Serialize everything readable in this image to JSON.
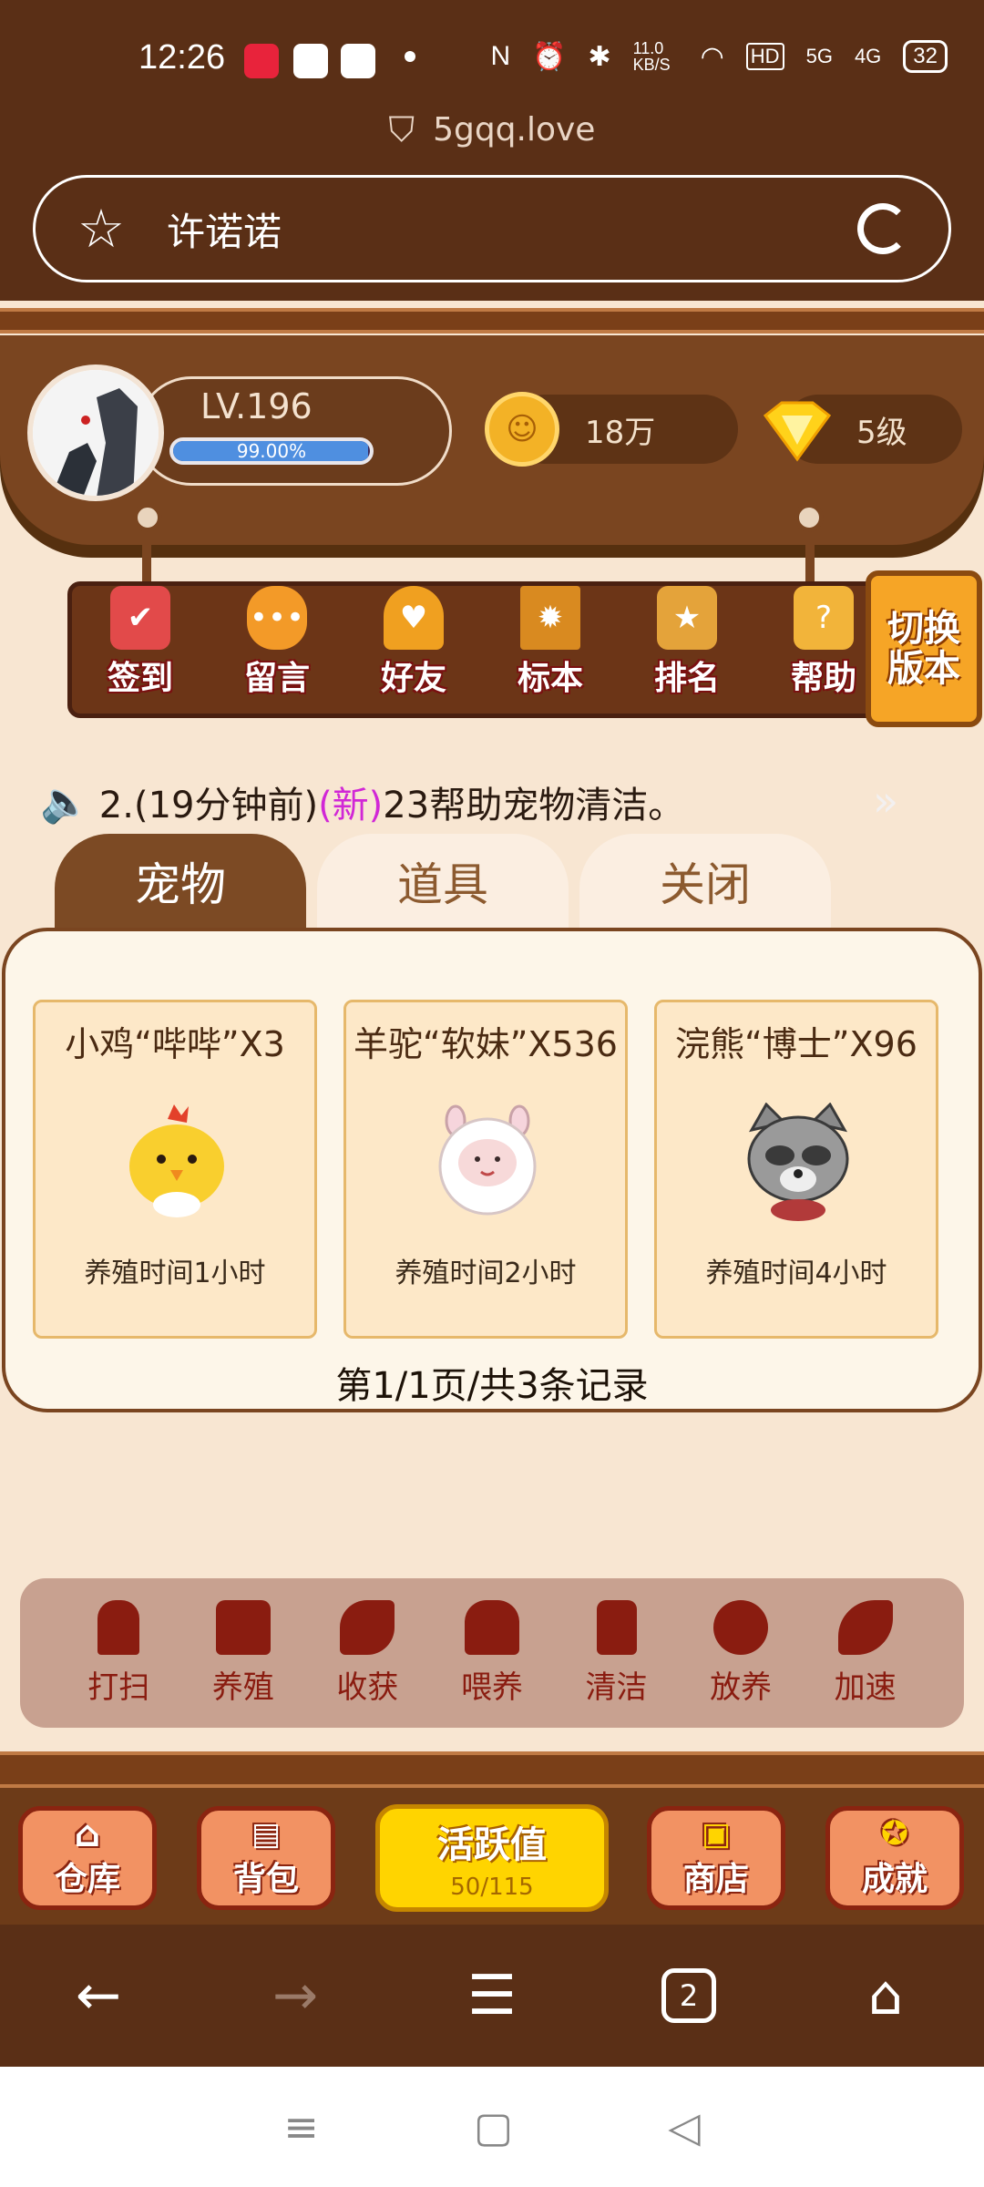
{
  "status": {
    "time": "12:26",
    "net_speed": "11.0 KB/S",
    "battery": "32",
    "hd_label": "HD",
    "sig1": "5G",
    "sig2": "4G"
  },
  "browser": {
    "url": "5gqq.love",
    "address_text": "许诺诺",
    "tab_count": "2"
  },
  "profile": {
    "level": "LV.196",
    "progress_pct": 0.99,
    "progress_label": "99.00%",
    "coins": "18万",
    "gem_level": "5级"
  },
  "nav": [
    {
      "label": "签到",
      "color": "#e24a4a"
    },
    {
      "label": "留言",
      "color": "#f39a28"
    },
    {
      "label": "好友",
      "color": "#f0a020"
    },
    {
      "label": "标本",
      "color": "#d98a20"
    },
    {
      "label": "排名",
      "color": "#e4a33a"
    },
    {
      "label": "帮助",
      "color": "#f2b43a"
    }
  ],
  "switch_button": "切换版本",
  "notice": {
    "prefix": "2.(19分钟前)",
    "tag": "(新)",
    "suffix": "23帮助宠物清洁。"
  },
  "tabs": [
    "宠物",
    "道具",
    "关闭"
  ],
  "pets": [
    {
      "name": "小鸡“哔哔”X3",
      "time": "养殖时间1小时"
    },
    {
      "name": "羊驼“软妹”X536",
      "time": "养殖时间2小时"
    },
    {
      "name": "浣熊“博士”X96",
      "time": "养殖时间4小时"
    }
  ],
  "pager": "第1/1页/共3条记录",
  "actions": [
    "打扫",
    "养殖",
    "收获",
    "喂养",
    "清洁",
    "放养",
    "加速"
  ],
  "bottom": {
    "warehouse": "仓库",
    "backpack": "背包",
    "activity_label": "活跃值",
    "activity_value": "50/115",
    "shop": "商店",
    "achievement": "成就"
  }
}
